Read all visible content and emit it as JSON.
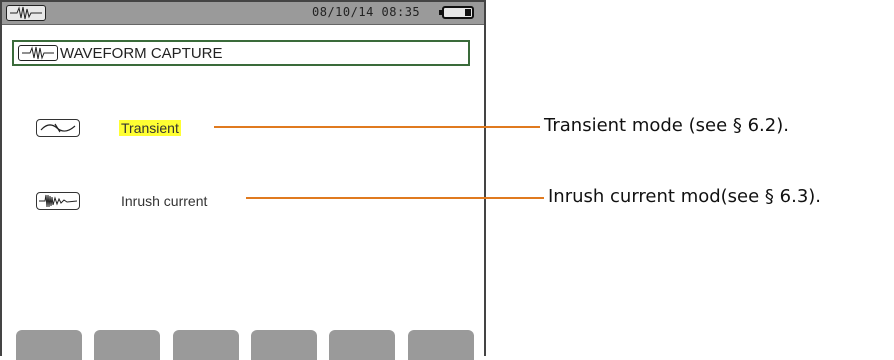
{
  "status_bar": {
    "datetime": "08/10/14 08:35",
    "mode_icon": "waveform-icon",
    "battery_icon": "battery-icon"
  },
  "title": {
    "icon": "waveform-capture-icon",
    "text": "WAVEFORM CAPTURE",
    "border_color": "#3a6b3a"
  },
  "menu": {
    "items": [
      {
        "icon": "transient-icon",
        "label": "Transient",
        "selected": true
      },
      {
        "icon": "inrush-icon",
        "label": "Inrush current",
        "selected": false
      }
    ]
  },
  "function_keys": [
    {
      "label": ""
    },
    {
      "label": ""
    },
    {
      "label": ""
    },
    {
      "label": ""
    },
    {
      "label": ""
    },
    {
      "label": ""
    }
  ],
  "callouts": [
    {
      "text": "Transient mode (see § 6.2)."
    },
    {
      "text": "Inrush current mod(see § 6.3)."
    }
  ],
  "colors": {
    "status_bar": "#9a9a9a",
    "highlight": "#ffff33",
    "callout_line": "#e07a1f",
    "function_key": "#9a9a9a"
  }
}
